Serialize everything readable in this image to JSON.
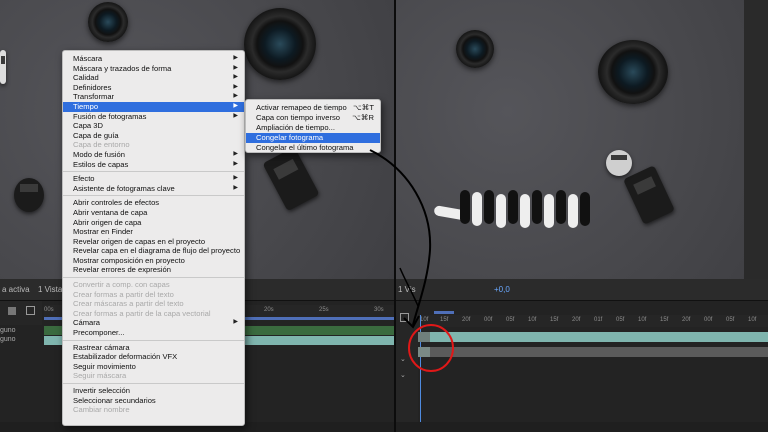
{
  "main_menu": {
    "items": [
      {
        "label": "Máscara",
        "arrow": true
      },
      {
        "label": "Máscara y trazados de forma",
        "arrow": true
      },
      {
        "label": "Calidad",
        "arrow": true
      },
      {
        "label": "Definidores",
        "arrow": true
      },
      {
        "label": "Transformar",
        "arrow": true
      },
      {
        "label": "Tiempo",
        "arrow": true,
        "highlighted": true
      },
      {
        "label": "Fusión de fotogramas",
        "arrow": true
      },
      {
        "label": "Capa 3D"
      },
      {
        "label": "Capa de guía"
      },
      {
        "label": "Capa de entorno",
        "disabled": true
      },
      {
        "label": "Modo de fusión",
        "arrow": true
      },
      {
        "label": "Estilos de capas",
        "arrow": true
      },
      {
        "separator": true
      },
      {
        "label": "Efecto",
        "arrow": true
      },
      {
        "label": "Asistente de fotogramas clave",
        "arrow": true
      },
      {
        "separator": true
      },
      {
        "label": "Abrir controles de efectos"
      },
      {
        "label": "Abrir ventana de capa"
      },
      {
        "label": "Abrir origen de capa"
      },
      {
        "label": "Mostrar en Finder"
      },
      {
        "label": "Revelar origen de capas en el proyecto"
      },
      {
        "label": "Revelar capa en el diagrama de flujo del proyecto"
      },
      {
        "label": "Mostrar composición en proyecto"
      },
      {
        "label": "Revelar errores de expresión"
      },
      {
        "separator": true
      },
      {
        "label": "Convertir a comp. con capas",
        "disabled": true
      },
      {
        "label": "Crear formas a partir del texto",
        "disabled": true
      },
      {
        "label": "Crear máscaras a partir del texto",
        "disabled": true
      },
      {
        "label": "Crear formas a partir de la capa vectorial",
        "disabled": true
      },
      {
        "label": "Cámara",
        "arrow": true
      },
      {
        "label": "Precomponer..."
      },
      {
        "separator": true
      },
      {
        "label": "Rastrear cámara"
      },
      {
        "label": "Estabilizador deformación VFX"
      },
      {
        "label": "Seguir movimiento"
      },
      {
        "label": "Seguir máscara",
        "disabled": true
      },
      {
        "separator": true
      },
      {
        "label": "Invertir selección"
      },
      {
        "label": "Seleccionar secundarios"
      },
      {
        "label": "Cambiar nombre",
        "disabled": true
      }
    ]
  },
  "time_submenu": {
    "items": [
      {
        "label": "Activar remapeo de tiempo",
        "shortcut": "⌥⌘T"
      },
      {
        "label": "Capa con tiempo inverso",
        "shortcut": "⌥⌘R"
      },
      {
        "label": "Ampliación de tiempo..."
      },
      {
        "label": "Congelar fotograma",
        "highlighted": true
      },
      {
        "label": "Congelar el último fotograma"
      }
    ]
  },
  "left_timeline": {
    "view_label": "a activa",
    "view_count": "1 Vista",
    "ruler_ticks": [
      "00s",
      "20s",
      "25s",
      "30s"
    ],
    "layer_labels": [
      "guno",
      "guno"
    ]
  },
  "right_timeline": {
    "view_count": "1 Vis",
    "zoom_value": "+0,0",
    "ruler_ticks": [
      "10f",
      "15f",
      "20f",
      "00f",
      "05f",
      "10f",
      "15f",
      "20f",
      "01f",
      "05f",
      "10f",
      "15f",
      "20f",
      "00f",
      "05f",
      "10f"
    ]
  },
  "colors": {
    "highlight": "#2f6ede",
    "annotation_circle": "#e01818",
    "track_teal": "#7fb5ae",
    "track_green": "#3a6a3f"
  }
}
